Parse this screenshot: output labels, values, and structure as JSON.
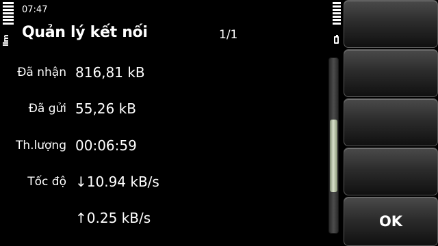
{
  "status": {
    "time": "07:47"
  },
  "header": {
    "title": "Quản lý kết nối",
    "pager": "1/1"
  },
  "details": [
    {
      "label": "Đã nhận",
      "value": "816,81 kB"
    },
    {
      "label": "Đã gửi",
      "value": "55,26 kB"
    },
    {
      "label": "Th.lượng",
      "value": "00:06:59"
    },
    {
      "label": "Tốc độ",
      "value": "↓10.94 kB/s"
    },
    {
      "label": "",
      "value": "↑0.25 kB/s"
    }
  ],
  "toolbar": {
    "ok_label": "OK"
  },
  "icons": {
    "signal": "signal-strength-icon",
    "network": "packet-data-icon",
    "battery": "battery-icon"
  },
  "colors": {
    "background": "#000000",
    "text": "#ffffff",
    "scroll_thumb": "#cfd8c2"
  }
}
